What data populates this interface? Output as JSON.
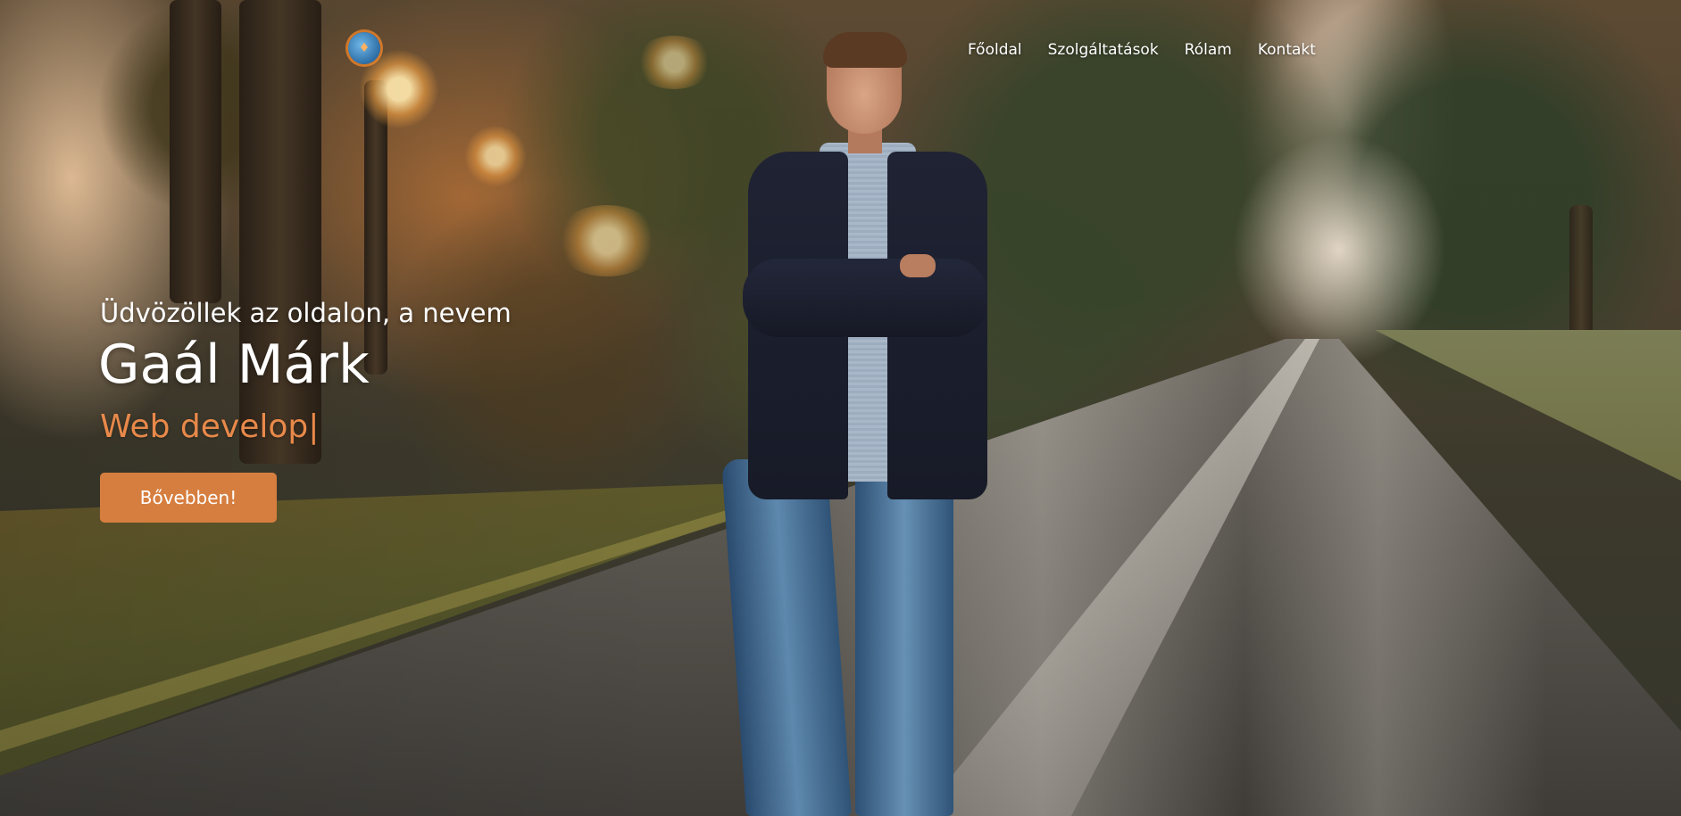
{
  "header": {
    "logo_icon": "orange-blue-monogram-logo-icon",
    "nav": [
      {
        "label": "Főoldal"
      },
      {
        "label": "Szolgáltatások"
      },
      {
        "label": "Rólam"
      },
      {
        "label": "Kontakt"
      }
    ]
  },
  "hero": {
    "greeting": "Üdvözöllek az oldalon, a nevem",
    "name": "Gaál Márk",
    "role_typed": "Web develop|",
    "cta_label": "Bővebben!"
  },
  "colors": {
    "accent": "#d67e3f",
    "role_text": "#e8894a",
    "nav_text": "#ffffff"
  }
}
